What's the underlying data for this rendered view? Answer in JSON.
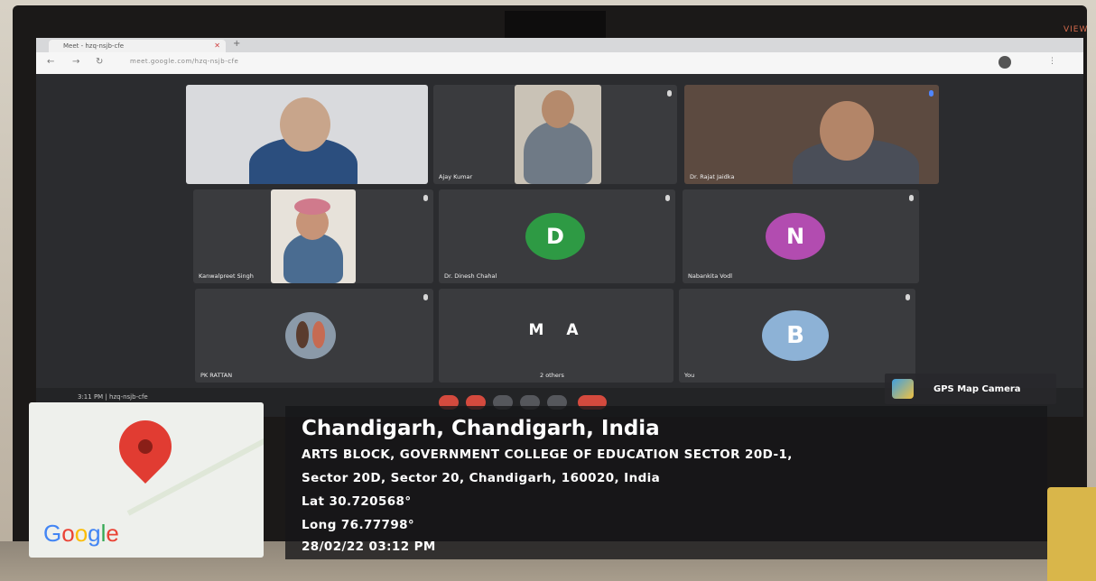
{
  "browser": {
    "tab_title": "Meet - hzq-nsjb-cfe",
    "url": "meet.google.com/hzq-nsjb-cfe",
    "brand": "VIEW"
  },
  "meeting": {
    "time_code": "3:11 PM | hzq-nsjb-cfe",
    "participants": [
      {
        "name": "",
        "type": "video"
      },
      {
        "name": "Ajay Kumar",
        "type": "video"
      },
      {
        "name": "Dr. Rajat Jaidka",
        "type": "video"
      },
      {
        "name": "Kanwalpreet Singh",
        "type": "video"
      },
      {
        "name": "Dr. Dinesh Chahal",
        "type": "avatar",
        "initial": "D",
        "color": "#2e9a44"
      },
      {
        "name": "Nabankita Vodl",
        "type": "avatar",
        "initial": "N",
        "color": "#b24cb0"
      },
      {
        "name": "PK RATTAN",
        "type": "video"
      },
      {
        "name": "2 others",
        "type": "avatar-pair",
        "initials": [
          "M",
          "A"
        ],
        "colors": [
          "#9a3a9a",
          "#1f6fc9"
        ]
      },
      {
        "name": "You",
        "type": "avatar",
        "initial": "B",
        "color": "#8db2d6"
      }
    ]
  },
  "overlay": {
    "app_name": "GPS Map Camera",
    "map_brand": "Google",
    "title": "Chandigarh, Chandigarh, India",
    "address_line1": "ARTS BLOCK, GOVERNMENT COLLEGE OF EDUCATION SECTOR 20D-1,",
    "address_line2": "Sector 20D, Sector 20, Chandigarh, 160020, India",
    "lat": "Lat 30.720568°",
    "long": "Long 76.77798°",
    "datetime": "28/02/22 03:12 PM"
  }
}
